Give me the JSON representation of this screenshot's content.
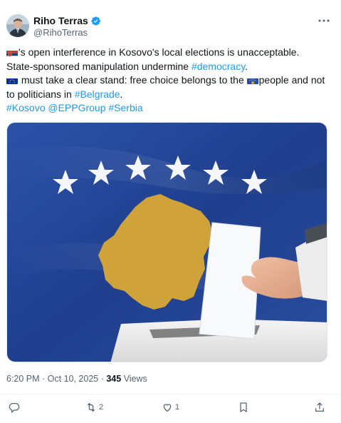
{
  "author": {
    "name": "Riho Terras",
    "handle": "@RihoTerras",
    "verified_icon": "verified-badge-icon"
  },
  "tweet": {
    "line1_text": "'s open interference in Kosovo's local elections is unacceptable.",
    "line2_prefix": "State-sponsored manipulation undermine ",
    "line2_link": "#democracy",
    "line2_suffix": ".",
    "line3_text_a": " must take a clear stand: free choice belongs to the ",
    "line3_text_b": "people and not",
    "line4_prefix": "to politicians in ",
    "line4_link": "#Belgrade",
    "line4_suffix": ".",
    "hashtags": "#Kosovo @EPPGroup #Serbia"
  },
  "meta": {
    "timestamp": "6:20 PM · Oct 10, 2025 · ",
    "views_count": "345",
    "views_label": " Views"
  },
  "actions": {
    "reply_count": "",
    "retweet_count": "2",
    "like_count": "1"
  },
  "colors": {
    "link": "#1d9bf0",
    "kosovo_blue": "#2a4d9e",
    "kosovo_gold": "#d0a23a"
  }
}
